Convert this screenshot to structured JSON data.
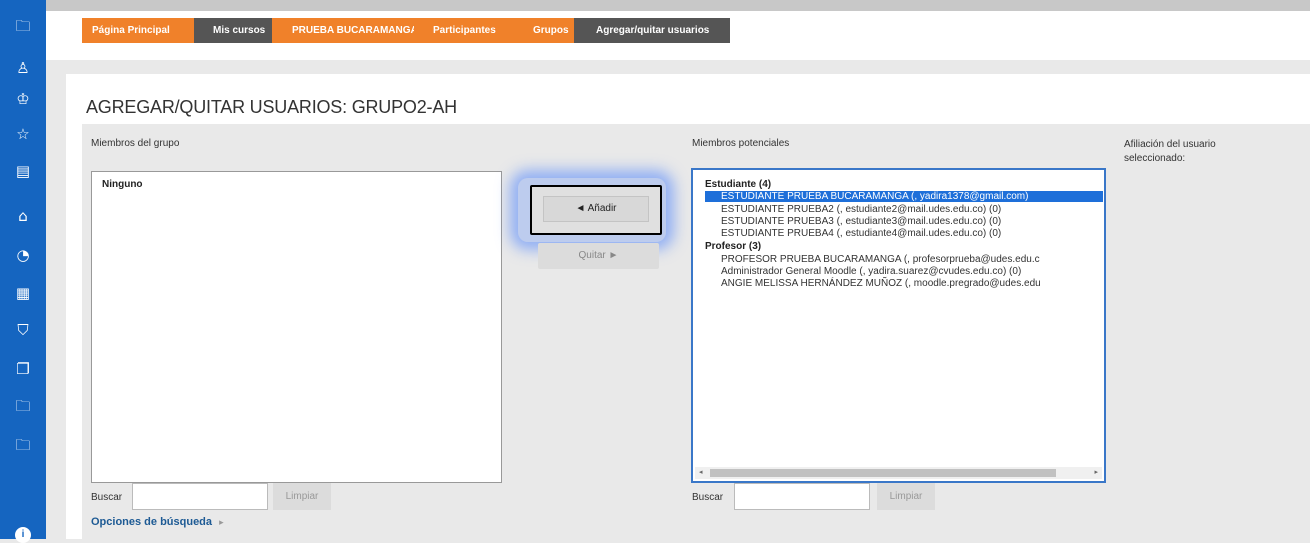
{
  "sidebar": {
    "items": [
      {
        "name": "folder-icon",
        "glyph": "🗀"
      },
      {
        "name": "user-badge-icon",
        "glyph": "♙"
      },
      {
        "name": "users-icon",
        "glyph": "♔"
      },
      {
        "name": "star-icon",
        "glyph": "☆"
      },
      {
        "name": "book-icon",
        "glyph": "▤"
      },
      {
        "name": "home-icon",
        "glyph": "⌂"
      },
      {
        "name": "dashboard-icon",
        "glyph": "◔"
      },
      {
        "name": "calendar-icon",
        "glyph": "▦"
      },
      {
        "name": "graduation-cap-icon",
        "glyph": "⛉"
      },
      {
        "name": "copy-icon",
        "glyph": "❐"
      },
      {
        "name": "folder-icon-2",
        "glyph": "🗀"
      },
      {
        "name": "folder-icon-3",
        "glyph": "🗀"
      }
    ],
    "color": "#1565c0"
  },
  "breadcrumb": {
    "items": [
      "Página Principal",
      "Mis cursos",
      "PRUEBA BUCARAMANGA",
      "Participantes",
      "Grupos",
      "Agregar/quitar usuarios"
    ],
    "colors": {
      "link": "#f0812a",
      "current": "#555555"
    }
  },
  "page": {
    "title": "AGREGAR/QUITAR USUARIOS: GRUPO2-AH"
  },
  "group_members": {
    "label": "Miembros del grupo",
    "empty_text": "Ninguno",
    "search_label": "Buscar",
    "search_value": "",
    "clear_label": "Limpiar",
    "search_options": "Opciones de búsqueda"
  },
  "actions": {
    "add": "◄ Añadir",
    "remove": "Quitar ►"
  },
  "potential_members": {
    "label": "Miembros potenciales",
    "groups": [
      {
        "title": "Estudiante (4)",
        "options": [
          {
            "text": "ESTUDIANTE PRUEBA BUCARAMANGA (, yadira1378@gmail.com)",
            "selected": true
          },
          {
            "text": "ESTUDIANTE PRUEBA2 (, estudiante2@mail.udes.edu.co) (0)",
            "selected": false
          },
          {
            "text": "ESTUDIANTE PRUEBA3 (, estudiante3@mail.udes.edu.co) (0)",
            "selected": false
          },
          {
            "text": "ESTUDIANTE PRUEBA4 (, estudiante4@mail.udes.edu.co) (0)",
            "selected": false
          }
        ]
      },
      {
        "title": "Profesor (3)",
        "options": [
          {
            "text": "PROFESOR PRUEBA BUCARAMANGA (, profesorprueba@udes.edu.c",
            "selected": false
          },
          {
            "text": "Administrador General Moodle (, yadira.suarez@cvudes.edu.co) (0)",
            "selected": false
          },
          {
            "text": "ANGIE MELISSA HERNÁNDEZ MUÑOZ (, moodle.pregrado@udes.edu",
            "selected": false
          }
        ]
      }
    ],
    "search_label": "Buscar",
    "search_value": "",
    "clear_label": "Limpiar"
  },
  "affiliation": {
    "label": "Afiliación del usuario seleccionado:"
  },
  "help": {
    "glyph": "i"
  }
}
